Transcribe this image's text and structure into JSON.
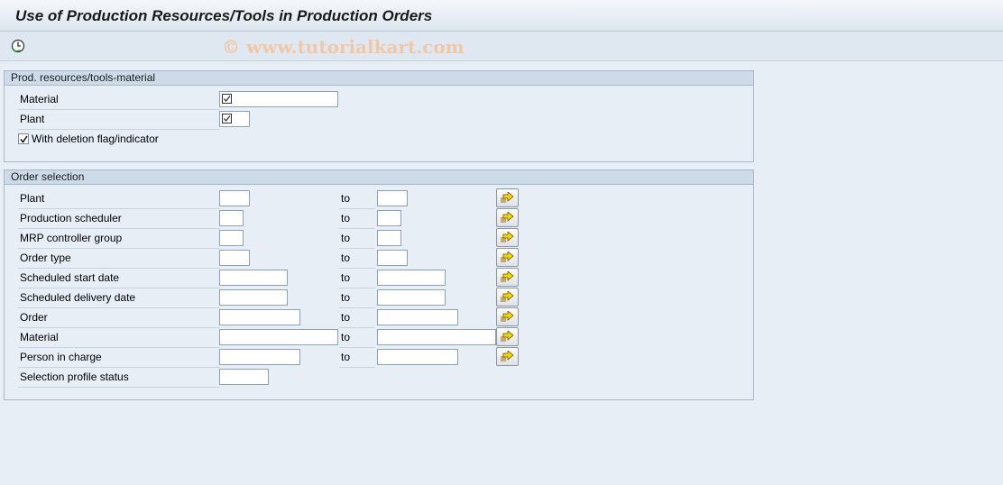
{
  "window": {
    "title": "Use of Production Resources/Tools in Production Orders"
  },
  "toolbar": {
    "execute_icon": "execute-clock-icon",
    "watermark": "© www.tutorialkart.com"
  },
  "material_group": {
    "header": "Prod. resources/tools-material",
    "material_label": "Material",
    "material_value": "",
    "plant_label": "Plant",
    "plant_value": "",
    "deletion_checkbox_label": "With deletion flag/indicator",
    "deletion_checked": true
  },
  "order_group": {
    "header": "Order selection",
    "to_label": "to",
    "rows": [
      {
        "label": "Plant",
        "from": "",
        "to": ""
      },
      {
        "label": "Production scheduler",
        "from": "",
        "to": ""
      },
      {
        "label": "MRP controller group",
        "from": "",
        "to": ""
      },
      {
        "label": "Order type",
        "from": "",
        "to": ""
      },
      {
        "label": "Scheduled start date",
        "from": "",
        "to": ""
      },
      {
        "label": "Scheduled delivery date",
        "from": "",
        "to": ""
      },
      {
        "label": "Order",
        "from": "",
        "to": ""
      },
      {
        "label": "Material",
        "from": "",
        "to": ""
      },
      {
        "label": "Person in charge",
        "from": "",
        "to": ""
      },
      {
        "label": "Selection profile status",
        "from": ""
      }
    ]
  },
  "colors": {
    "background": "#e7eef6",
    "group_header": "#cddbe8",
    "multi_select_arrow": "#f2d600"
  }
}
